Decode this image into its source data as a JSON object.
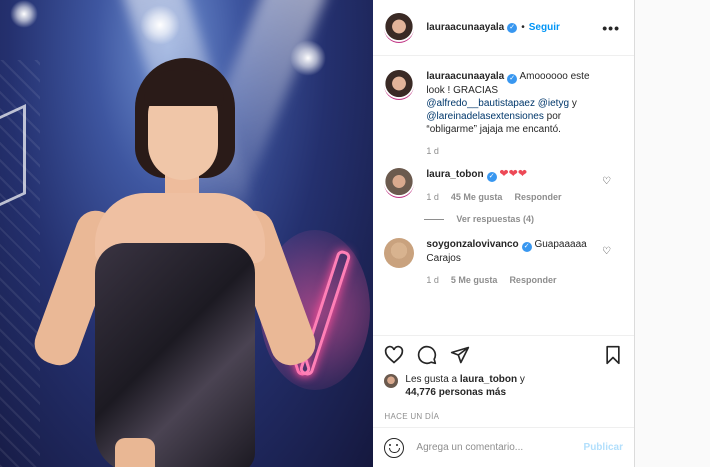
{
  "header": {
    "username": "lauraacunaayala",
    "separator": "•",
    "follow_label": "Seguir",
    "more_label": "•••"
  },
  "caption": {
    "username": "lauraacunaayala",
    "text_start": "Amoooooo este look ! GRACIAS",
    "mention1": "@alfredo__bautistapaez",
    "mention2": "@ietyg",
    "connector": "y",
    "mention3": "@lareinadelasextensiones",
    "text_end": "por “obligarme” jajaja me encantó.",
    "time": "1 d"
  },
  "comments": [
    {
      "username": "laura_tobon",
      "text": "❤❤❤",
      "time": "1 d",
      "likes": "45 Me gusta",
      "reply_label": "Responder",
      "view_replies": "Ver respuestas (4)"
    },
    {
      "username": "soygonzalovivanco",
      "text": "Guapaaaaa Carajos",
      "time": "1 d",
      "likes": "5 Me gusta",
      "reply_label": "Responder"
    }
  ],
  "likes": {
    "prefix": "Les gusta a",
    "user": "laura_tobon",
    "connector": "y",
    "count": "44,776 personas más"
  },
  "timestamp": "HACE UN DÍA",
  "add_comment": {
    "placeholder": "Agrega un comentario...",
    "publish_label": "Publicar"
  },
  "colors": {
    "link_blue": "#0095f6",
    "verified_blue": "#3897f0",
    "heart_red": "#ed4956",
    "publish_disabled": "#b2dffc"
  },
  "icons": [
    "heart-icon",
    "comment-icon",
    "share-icon",
    "bookmark-icon",
    "emoji-icon",
    "verified-icon",
    "more-icon"
  ]
}
